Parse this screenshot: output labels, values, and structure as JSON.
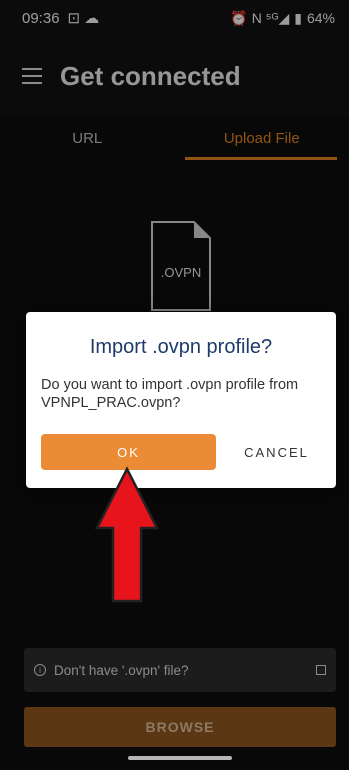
{
  "status_bar": {
    "time": "09:36",
    "notif_icons": "⊡ ☁",
    "right_icons": "⏰ N ⁵ᴳ◢",
    "battery": "64%"
  },
  "appbar": {
    "title": "Get connected"
  },
  "tabs": [
    {
      "label": "URL",
      "active": false
    },
    {
      "label": "Upload File",
      "active": true
    }
  ],
  "file_icon": {
    "label": ".OVPN"
  },
  "dialog": {
    "title": "Import .ovpn profile?",
    "message": "Do you want to import .ovpn profile from VPNPL_PRAC.ovpn?",
    "ok_label": "OK",
    "cancel_label": "CANCEL"
  },
  "help": {
    "text": "Don't have '.ovpn' file?"
  },
  "browse": {
    "label": "BROWSE"
  },
  "colors": {
    "accent": "#e07f20",
    "arrow": "#e8141c",
    "dialog_title": "#1f3b6a"
  }
}
